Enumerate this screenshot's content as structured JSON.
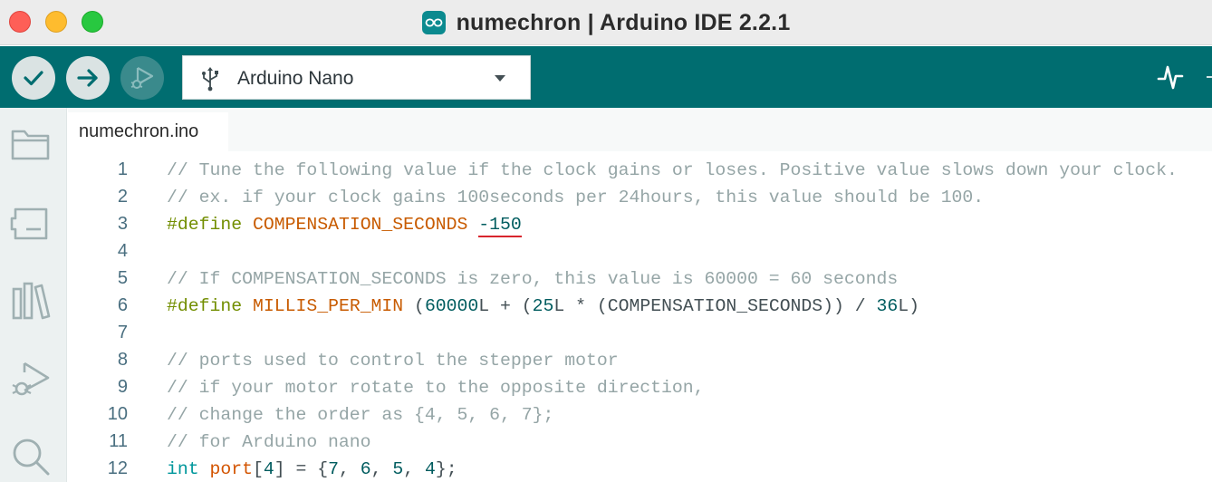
{
  "window": {
    "title": "numechron | Arduino IDE 2.2.1"
  },
  "toolbar": {
    "verify_icon": "checkmark-icon",
    "upload_icon": "arrow-right-icon",
    "debug_icon": "debug-icon",
    "board_select": {
      "icon": "usb-icon",
      "value": "Arduino Nano",
      "caret_icon": "chevron-down-icon"
    },
    "serial_plotter_icon": "serial-plotter-icon"
  },
  "sidebar": {
    "items": [
      {
        "name": "sketchbook",
        "icon": "folder-icon"
      },
      {
        "name": "boards-manager",
        "icon": "board-icon"
      },
      {
        "name": "library-manager",
        "icon": "library-icon"
      },
      {
        "name": "debug",
        "icon": "debug-icon"
      },
      {
        "name": "search",
        "icon": "search-icon"
      }
    ]
  },
  "editor": {
    "tabs": [
      {
        "label": "numechron.ino",
        "active": true
      }
    ],
    "lines": [
      {
        "number": "1",
        "segments": [
          {
            "type": "comment",
            "text": "// Tune the following value if the clock gains or loses. Positive value slows down your clock."
          }
        ]
      },
      {
        "number": "2",
        "segments": [
          {
            "type": "comment",
            "text": "// ex. if your clock gains 100seconds per 24hours, this value should be 100."
          }
        ]
      },
      {
        "number": "3",
        "segments": [
          {
            "type": "kw",
            "text": "#define"
          },
          {
            "type": "plain",
            "text": " "
          },
          {
            "type": "const",
            "text": "COMPENSATION_SECONDS"
          },
          {
            "type": "plain",
            "text": " "
          },
          {
            "type": "num-error",
            "text": "-150"
          }
        ]
      },
      {
        "number": "4",
        "segments": [
          {
            "type": "plain",
            "text": ""
          }
        ]
      },
      {
        "number": "5",
        "segments": [
          {
            "type": "comment",
            "text": "// If COMPENSATION_SECONDS is zero, this value is 60000 = 60 seconds"
          }
        ]
      },
      {
        "number": "6",
        "segments": [
          {
            "type": "kw",
            "text": "#define"
          },
          {
            "type": "plain",
            "text": " "
          },
          {
            "type": "const",
            "text": "MILLIS_PER_MIN"
          },
          {
            "type": "plain",
            "text": " ("
          },
          {
            "type": "num",
            "text": "60000"
          },
          {
            "type": "plain",
            "text": "L + ("
          },
          {
            "type": "num",
            "text": "25"
          },
          {
            "type": "plain",
            "text": "L * (COMPENSATION_SECONDS)) / "
          },
          {
            "type": "num",
            "text": "36"
          },
          {
            "type": "plain",
            "text": "L)"
          }
        ]
      },
      {
        "number": "7",
        "segments": [
          {
            "type": "plain",
            "text": ""
          }
        ]
      },
      {
        "number": "8",
        "segments": [
          {
            "type": "comment",
            "text": "// ports used to control the stepper motor"
          }
        ]
      },
      {
        "number": "9",
        "segments": [
          {
            "type": "comment",
            "text": "// if your motor rotate to the opposite direction,"
          }
        ]
      },
      {
        "number": "10",
        "segments": [
          {
            "type": "comment",
            "text": "// change the order as {4, 5, 6, 7};"
          }
        ]
      },
      {
        "number": "11",
        "segments": [
          {
            "type": "comment",
            "text": "// for Arduino nano"
          }
        ]
      },
      {
        "number": "12",
        "segments": [
          {
            "type": "type",
            "text": "int"
          },
          {
            "type": "plain",
            "text": " "
          },
          {
            "type": "ident",
            "text": "port"
          },
          {
            "type": "plain",
            "text": "["
          },
          {
            "type": "num",
            "text": "4"
          },
          {
            "type": "plain",
            "text": "] = {"
          },
          {
            "type": "num",
            "text": "7"
          },
          {
            "type": "plain",
            "text": ", "
          },
          {
            "type": "num",
            "text": "6"
          },
          {
            "type": "plain",
            "text": ", "
          },
          {
            "type": "num",
            "text": "5"
          },
          {
            "type": "plain",
            "text": ", "
          },
          {
            "type": "num",
            "text": "4"
          },
          {
            "type": "plain",
            "text": "};"
          }
        ]
      }
    ]
  },
  "colors": {
    "toolbar_bg": "#006d70",
    "titlebar_bg": "#ececec",
    "comment": "#95a5a6",
    "keyword": "#728e00",
    "constant": "#c85b00",
    "number": "#005c5f",
    "error_underline": "#d8252d"
  }
}
